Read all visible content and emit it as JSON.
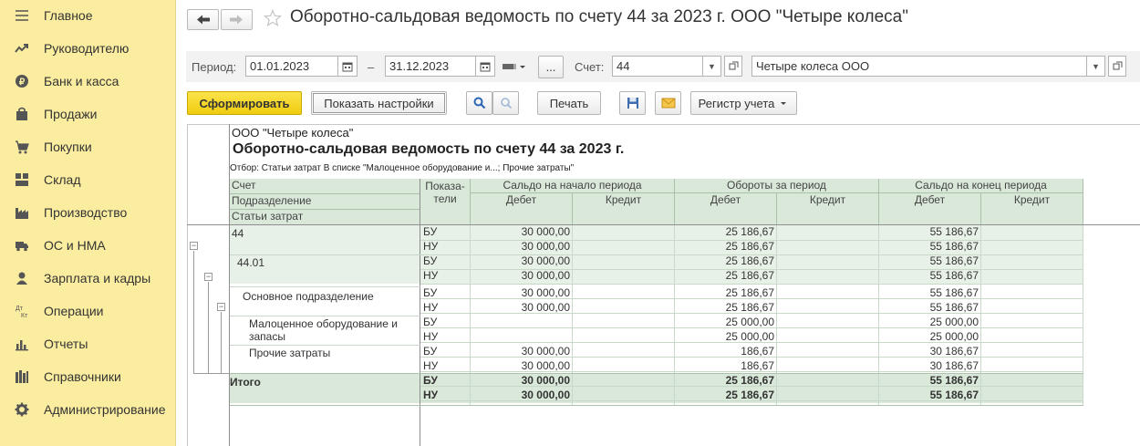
{
  "sidebar": {
    "items": [
      {
        "label": "Главное",
        "icon": "menu-icon"
      },
      {
        "label": "Руководителю",
        "icon": "trend-icon"
      },
      {
        "label": "Банк и касса",
        "icon": "coin-icon"
      },
      {
        "label": "Продажи",
        "icon": "bag-icon"
      },
      {
        "label": "Покупки",
        "icon": "cart-icon"
      },
      {
        "label": "Склад",
        "icon": "warehouse-icon"
      },
      {
        "label": "Производство",
        "icon": "factory-icon"
      },
      {
        "label": "ОС и НМА",
        "icon": "truck-icon"
      },
      {
        "label": "Зарплата и кадры",
        "icon": "person-icon"
      },
      {
        "label": "Операции",
        "icon": "dt-kt-icon"
      },
      {
        "label": "Отчеты",
        "icon": "bar-chart-icon"
      },
      {
        "label": "Справочники",
        "icon": "books-icon"
      },
      {
        "label": "Администрирование",
        "icon": "gear-icon"
      }
    ]
  },
  "header": {
    "title": "Оборотно-сальдовая ведомость по счету 44 за 2023 г. ООО \"Четыре колеса\""
  },
  "period_bar": {
    "period_label": "Период:",
    "date_from": "01.01.2023",
    "dash": "–",
    "date_to": "31.12.2023",
    "ellipsis": "...",
    "account_label": "Счет:",
    "account": "44",
    "organization": "Четыре колеса ООО"
  },
  "toolbar": {
    "generate": "Сформировать",
    "settings": "Показать настройки",
    "print": "Печать",
    "register": "Регистр учета"
  },
  "report": {
    "org": "ООО \"Четыре колеса\"",
    "title": "Оборотно-сальдовая ведомость по счету 44 за 2023 г.",
    "filter": "Отбор: Статьи затрат В списке \"Малоценное оборудование и...; Прочие затраты\"",
    "headers": {
      "account": "Счет",
      "department": "Подразделение",
      "cost_items": "Статьи затрат",
      "indicators": "Показа-\nтели",
      "opening": "Сальдо на начало периода",
      "turnover": "Обороты за период",
      "closing": "Сальдо на конец периода",
      "debit": "Дебет",
      "credit": "Кредит"
    },
    "rows": [
      {
        "name": "44",
        "ind": [
          "БУ",
          "НУ"
        ],
        "od": [
          "30 000,00",
          "30 000,00"
        ],
        "td": [
          "25 186,67",
          "25 186,67"
        ],
        "cd": [
          "55 186,67",
          "55 186,67"
        ]
      },
      {
        "name": "44.01",
        "ind": [
          "БУ",
          "НУ"
        ],
        "od": [
          "30 000,00",
          "30 000,00"
        ],
        "td": [
          "25 186,67",
          "25 186,67"
        ],
        "cd": [
          "55 186,67",
          "55 186,67"
        ]
      },
      {
        "name": "Основное подразделение",
        "ind": [
          "БУ",
          "НУ"
        ],
        "od": [
          "30 000,00",
          "30 000,00"
        ],
        "td": [
          "25 186,67",
          "25 186,67"
        ],
        "cd": [
          "55 186,67",
          "55 186,67"
        ]
      },
      {
        "name": "Малоценное оборудование и\nзапасы",
        "ind": [
          "БУ",
          "НУ"
        ],
        "od": [
          "",
          ""
        ],
        "td": [
          "25 000,00",
          "25 000,00"
        ],
        "cd": [
          "25 000,00",
          "25 000,00"
        ]
      },
      {
        "name": "Прочие затраты",
        "ind": [
          "БУ",
          "НУ"
        ],
        "od": [
          "30 000,00",
          "30 000,00"
        ],
        "td": [
          "186,67",
          "186,67"
        ],
        "cd": [
          "30 186,67",
          "30 186,67"
        ]
      },
      {
        "name": "Итого",
        "ind": [
          "БУ",
          "НУ"
        ],
        "od": [
          "30 000,00",
          "30 000,00"
        ],
        "td": [
          "25 186,67",
          "25 186,67"
        ],
        "cd": [
          "55 186,67",
          "55 186,67"
        ]
      }
    ]
  }
}
